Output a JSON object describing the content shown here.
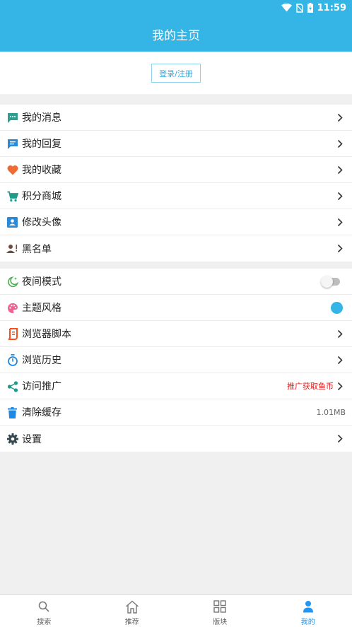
{
  "status_bar": {
    "time": "11:59"
  },
  "header": {
    "title": "我的主页"
  },
  "login": {
    "label": "登录/注册"
  },
  "menu_group_1": [
    {
      "label": "我的消息",
      "icon": "message-icon",
      "color": "#2e9e8f"
    },
    {
      "label": "我的回复",
      "icon": "reply-icon",
      "color": "#2b8ad8"
    },
    {
      "label": "我的收藏",
      "icon": "heart-icon",
      "color": "#f06a35"
    },
    {
      "label": "积分商城",
      "icon": "cart-icon",
      "color": "#1f9b8c"
    },
    {
      "label": "修改头像",
      "icon": "portrait-icon",
      "color": "#2b8ad8"
    },
    {
      "label": "黑名单",
      "icon": "blocked-user-icon",
      "color": "#6d4c41"
    }
  ],
  "menu_group_2": [
    {
      "label": "夜间模式",
      "icon": "night-mode-icon",
      "color": "#4caf50",
      "toggle_on": false
    },
    {
      "label": "主题风格",
      "icon": "palette-icon",
      "color": "#f06292",
      "theme_color": "#35b4e6"
    },
    {
      "label": "浏览器脚本",
      "icon": "script-icon",
      "color": "#f4511e"
    },
    {
      "label": "浏览历史",
      "icon": "timer-icon",
      "color": "#1e88e5"
    },
    {
      "label": "访问推广",
      "icon": "share-icon",
      "color": "#1f9b8c",
      "right_text": "推广获取鱼币"
    },
    {
      "label": "清除缓存",
      "icon": "trash-icon",
      "color": "#1e88e5",
      "right_text": "1.01MB"
    },
    {
      "label": "设置",
      "icon": "gear-icon",
      "color": "#37474f"
    }
  ],
  "bottom_nav": [
    {
      "label": "搜索",
      "icon": "search-icon"
    },
    {
      "label": "推荐",
      "icon": "home-icon"
    },
    {
      "label": "版块",
      "icon": "grid-icon"
    },
    {
      "label": "我的",
      "icon": "person-icon",
      "active": true
    }
  ],
  "colors": {
    "brand": "#35b4e6",
    "active_tab": "#2196f3",
    "promo_text": "#e0201e"
  }
}
